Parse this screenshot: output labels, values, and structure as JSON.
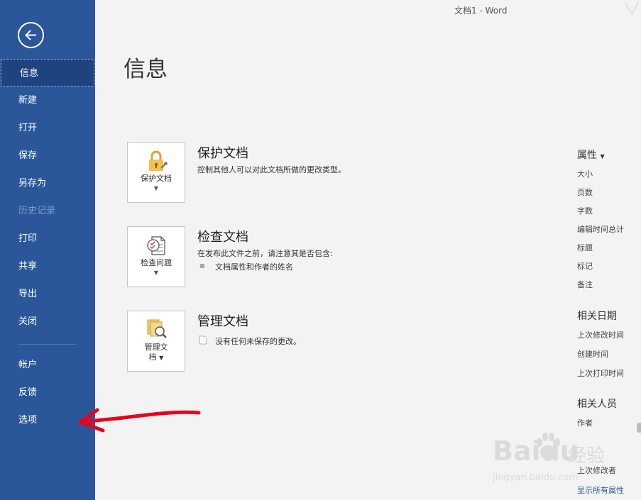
{
  "window": {
    "title": "文档1  -  Word"
  },
  "sidebar": {
    "items": [
      {
        "label": "信息",
        "active": true
      },
      {
        "label": "新建"
      },
      {
        "label": "打开"
      },
      {
        "label": "保存"
      },
      {
        "label": "另存为"
      },
      {
        "label": "历史记录",
        "disabled": true
      },
      {
        "label": "打印"
      },
      {
        "label": "共享"
      },
      {
        "label": "导出"
      },
      {
        "label": "关闭"
      }
    ],
    "footer_items": [
      {
        "label": "帐户"
      },
      {
        "label": "反馈"
      },
      {
        "label": "选项"
      }
    ]
  },
  "main": {
    "title": "信息",
    "protect": {
      "button_label": "保护文档",
      "heading": "保护文档",
      "description": "控制其他人可以对此文档所做的更改类型。"
    },
    "inspect": {
      "button_label": "检查问题",
      "heading": "检查文档",
      "description": "在发布此文件之前，请注意其是否包含:",
      "bullet": "文档属性和作者的姓名"
    },
    "manage": {
      "button_label_line1": "管理文",
      "button_label_line2": "档",
      "heading": "管理文档",
      "description": "没有任何未保存的更改。"
    }
  },
  "properties": {
    "heading": "属性",
    "items": [
      "大小",
      "页数",
      "字数",
      "编辑时间总计",
      "标题",
      "标记",
      "备注"
    ],
    "dates_heading": "相关日期",
    "dates": [
      "上次修改时间",
      "创建时间",
      "上次打印时间"
    ],
    "people_heading": "相关人员",
    "people": [
      "作者",
      "上次修改者"
    ],
    "show_all": "显示所有属性"
  },
  "watermark": {
    "brand": "Baidu",
    "suffix": "经验",
    "url": "jingyan.baidu.com"
  },
  "colors": {
    "sidebar": "#2b579a",
    "sidebar_active": "#1e4380",
    "annotation_arrow": "#e8001c"
  }
}
